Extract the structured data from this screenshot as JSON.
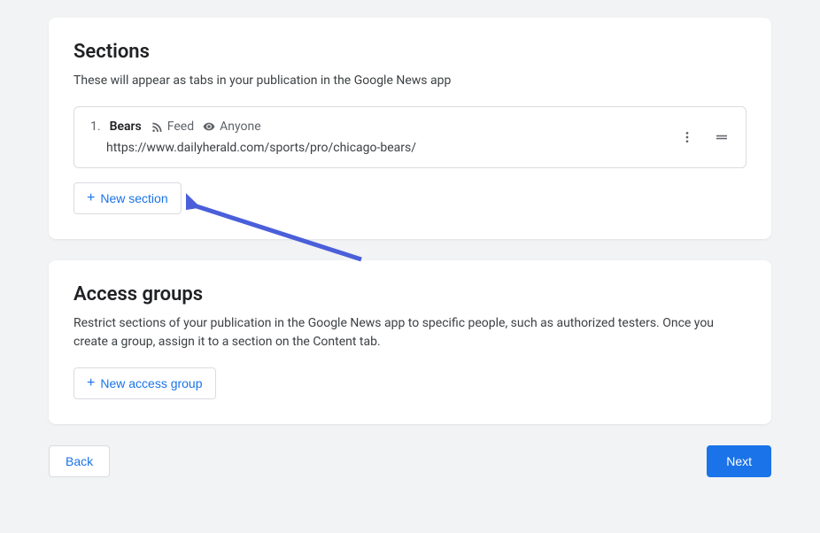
{
  "sections_card": {
    "title": "Sections",
    "description": "These will appear as tabs in your publication in the Google News app",
    "items": [
      {
        "number": "1.",
        "name": "Bears",
        "type_label": "Feed",
        "access_label": "Anyone",
        "url": "https://www.dailyherald.com/sports/pro/chicago-bears/"
      }
    ],
    "new_button": "New section"
  },
  "access_card": {
    "title": "Access groups",
    "description": "Restrict sections of your publication in the Google News app to specific people, such as authorized testers. Once you create a group, assign it to a section on the Content tab.",
    "new_button": "New access group"
  },
  "footer": {
    "back_label": "Back",
    "next_label": "Next"
  }
}
